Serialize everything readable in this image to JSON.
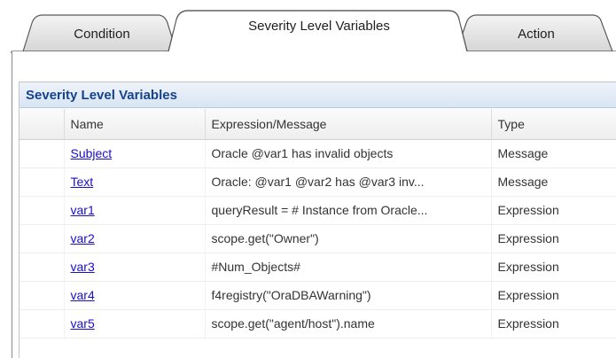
{
  "tabs": [
    {
      "label": "Condition",
      "active": false
    },
    {
      "label": "Severity Level Variables",
      "active": true
    },
    {
      "label": "Action",
      "active": false
    }
  ],
  "section": {
    "title": "Severity Level Variables"
  },
  "table": {
    "columns": [
      "Name",
      "Expression/Message",
      "Type"
    ],
    "rows": [
      {
        "name": "Subject",
        "expression": "Oracle @var1 has invalid objects",
        "type": "Message"
      },
      {
        "name": "Text",
        "expression": "Oracle: @var1 @var2 has @var3 inv...",
        "type": "Message"
      },
      {
        "name": "var1",
        "expression": "queryResult = # Instance from Oracle...",
        "type": "Expression"
      },
      {
        "name": "var2",
        "expression": "scope.get(\"Owner\")",
        "type": "Expression"
      },
      {
        "name": "var3",
        "expression": "#Num_Objects#",
        "type": "Expression"
      },
      {
        "name": "var4",
        "expression": "f4registry(\"OraDBAWarning\")",
        "type": "Expression"
      },
      {
        "name": "var5",
        "expression": "scope.get(\"agent/host\").name",
        "type": "Expression"
      }
    ]
  },
  "colors": {
    "link": "#1a0dcc",
    "header_text": "#15428b",
    "header_bg": "#dfe8f6"
  }
}
